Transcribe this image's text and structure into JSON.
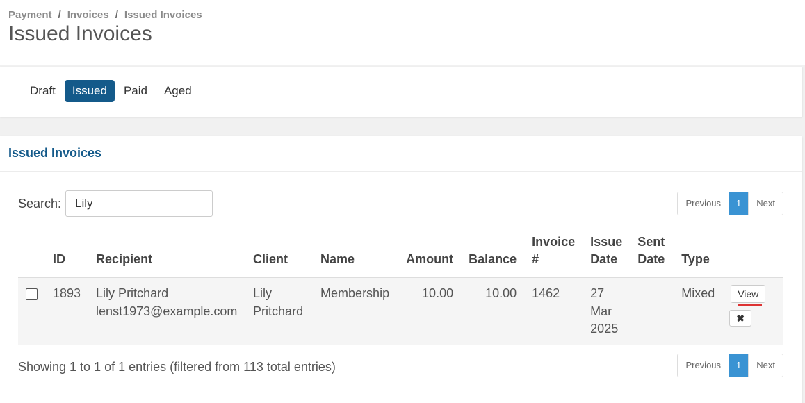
{
  "breadcrumb": {
    "items": [
      "Payment",
      "Invoices",
      "Issued Invoices"
    ],
    "separator": "/"
  },
  "page_title": "Issued Invoices",
  "tabs": [
    {
      "label": "Draft",
      "active": false
    },
    {
      "label": "Issued",
      "active": true
    },
    {
      "label": "Paid",
      "active": false
    },
    {
      "label": "Aged",
      "active": false
    }
  ],
  "card": {
    "title": "Issued Invoices",
    "search": {
      "label": "Search:",
      "value": "Lily",
      "placeholder": ""
    },
    "pager": {
      "previous": "Previous",
      "page": "1",
      "next": "Next"
    },
    "columns": [
      "ID",
      "Recipient",
      "Client",
      "Name",
      "Amount",
      "Balance",
      "Invoice #",
      "Issue Date",
      "Sent Date",
      "Type"
    ],
    "rows": [
      {
        "id": "1893",
        "recipient_name": "Lily Pritchard",
        "recipient_email": "lenst1973@example.com",
        "client": "Lily Pritchard",
        "name": "Membership",
        "amount": "10.00",
        "balance": "10.00",
        "invoice_no": "1462",
        "issue_date": "27 Mar 2025",
        "sent_date": "",
        "type": "Mixed",
        "view_label": "View",
        "delete_glyph": "✖"
      }
    ],
    "showing": "Showing 1 to 1 of 1 entries (filtered from 113 total entries)"
  },
  "colors": {
    "accent": "#145a8a",
    "pager_active": "#3a93d3"
  }
}
